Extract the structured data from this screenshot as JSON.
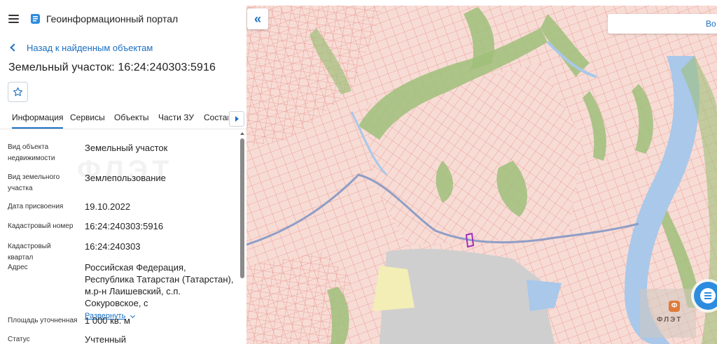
{
  "app": {
    "title": "Геоинформационный портал"
  },
  "navigation": {
    "back_label": "Назад к найденным объектам"
  },
  "object": {
    "title": "Земельный участок: 16:24:240303:5916"
  },
  "tabs": [
    {
      "label": "Информация",
      "active": true
    },
    {
      "label": "Сервисы",
      "active": false
    },
    {
      "label": "Объекты",
      "active": false
    },
    {
      "label": "Части ЗУ",
      "active": false
    },
    {
      "label": "Состав",
      "active": false
    }
  ],
  "attributes": [
    {
      "label": "Вид объекта недвижимости",
      "value": "Земельный участок"
    },
    {
      "label": "Вид земельного участка",
      "value": "Землепользование"
    },
    {
      "label": "Дата присвоения",
      "value": "19.10.2022"
    },
    {
      "label": "Кадастровый номер",
      "value": "16:24:240303:5916"
    },
    {
      "label": "Кадастровый квартал",
      "value": "16:24:240303"
    },
    {
      "label": "Адрес",
      "value": "Российская Федерация, Республика Татарстан (Татарстан), м.р-н Лаишевский, с.п. Сокуровское, с"
    },
    {
      "label": "Площадь уточненная",
      "value": "1 000 кв. м"
    },
    {
      "label": "Статус",
      "value": "Учтенный"
    }
  ],
  "address_expand_label": "Развернуть",
  "watermark": "ФЛЭТ",
  "map": {
    "search_label": "Во",
    "brand_text": "ФЛЭТ",
    "brand_logo_letter": "Ф",
    "colors": {
      "background": "#f7dcd5",
      "parcel_line": "#e7908a",
      "vegetation": "#9fbf7a",
      "water": "#a9c8ea",
      "highlight": "#a02dbd",
      "industrial": "#cfcfcf",
      "field": "#f3eeb5"
    }
  },
  "icons": {
    "menu": "hamburger-icon",
    "logo": "portal-logo-icon",
    "back": "chevron-left-icon",
    "favorite": "star-icon",
    "tabs_scroll": "triangle-right-icon",
    "collapse": "double-chevron-left-icon",
    "chat": "chat-icon"
  }
}
